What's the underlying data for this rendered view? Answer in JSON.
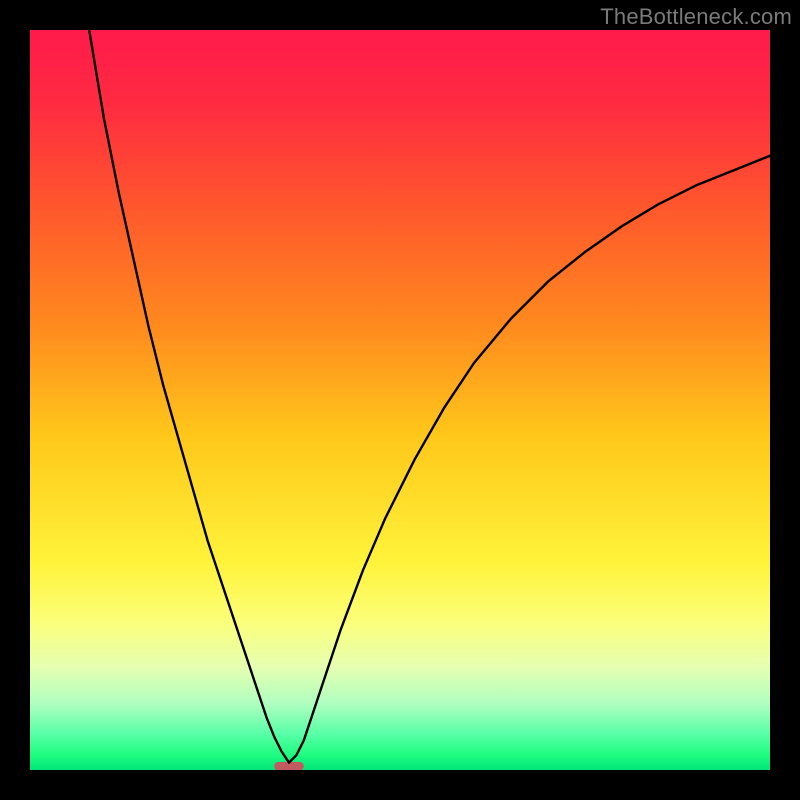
{
  "watermark": "TheBottleneck.com",
  "chart_data": {
    "type": "line",
    "title": "",
    "xlabel": "",
    "ylabel": "",
    "xrange": [
      0,
      100
    ],
    "yrange": [
      0,
      100
    ],
    "ticks_visible": false,
    "grid": false,
    "background_gradient": {
      "direction": "vertical",
      "stops": [
        {
          "pos": 0.0,
          "color": "#ff1a4b"
        },
        {
          "pos": 0.1,
          "color": "#ff2b41"
        },
        {
          "pos": 0.25,
          "color": "#ff5a2b"
        },
        {
          "pos": 0.4,
          "color": "#ff8a1e"
        },
        {
          "pos": 0.55,
          "color": "#ffc81a"
        },
        {
          "pos": 0.72,
          "color": "#fff33a"
        },
        {
          "pos": 0.8,
          "color": "#fbff7a"
        },
        {
          "pos": 0.86,
          "color": "#e6ffb0"
        },
        {
          "pos": 0.91,
          "color": "#b0ffc0"
        },
        {
          "pos": 0.95,
          "color": "#5bffa8"
        },
        {
          "pos": 0.98,
          "color": "#1efc80"
        },
        {
          "pos": 1.0,
          "color": "#00e67a"
        }
      ]
    },
    "marker": {
      "x": 35,
      "y": 0.5,
      "color": "#c25b5f",
      "width": 4,
      "height": 1.2
    },
    "series": [
      {
        "name": "curve",
        "color": "#000000",
        "x": [
          8,
          9,
          10,
          12,
          14,
          16,
          18,
          20,
          22,
          24,
          26,
          28,
          30,
          32,
          33,
          34,
          35,
          36,
          37,
          38,
          40,
          42,
          45,
          48,
          52,
          56,
          60,
          65,
          70,
          75,
          80,
          85,
          90,
          95,
          100
        ],
        "values": [
          100,
          94,
          88,
          78,
          69,
          60,
          52,
          45,
          38,
          31,
          25,
          19,
          13,
          7,
          4.5,
          2.5,
          1,
          2,
          4,
          7,
          13,
          19,
          27,
          34,
          42,
          49,
          55,
          61,
          66,
          70,
          73.5,
          76.5,
          79,
          81,
          83
        ]
      }
    ]
  }
}
